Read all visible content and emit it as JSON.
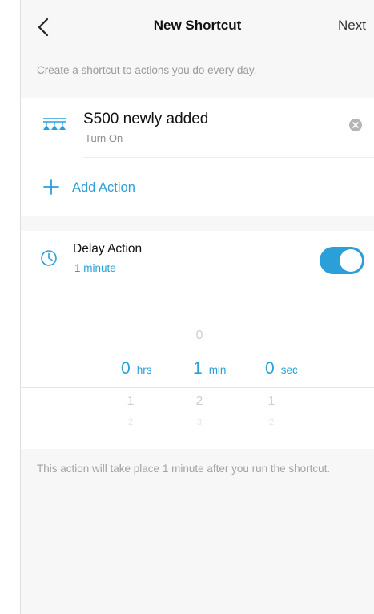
{
  "header": {
    "title": "New Shortcut",
    "next_label": "Next"
  },
  "subtitle": "Create a shortcut to actions you do every day.",
  "actions": [
    {
      "device_name": "S500 newly added",
      "action": "Turn On",
      "icon": "light-strip-icon"
    }
  ],
  "add_action_label": "Add Action",
  "delay": {
    "title": "Delay Action",
    "value": "1 minute",
    "enabled": true
  },
  "picker": {
    "hours": {
      "prev": "",
      "selected": "0",
      "next": "1",
      "next2": "2",
      "unit": "hrs"
    },
    "minutes": {
      "prev": "0",
      "selected": "1",
      "next": "2",
      "next2": "3",
      "unit": "min"
    },
    "seconds": {
      "prev": "",
      "selected": "0",
      "next": "1",
      "next2": "2",
      "unit": "sec"
    }
  },
  "footer_note": "This action will take place 1 minute after you run the shortcut.",
  "colors": {
    "accent": "#2a9fd8",
    "background": "#f7f7f7"
  }
}
